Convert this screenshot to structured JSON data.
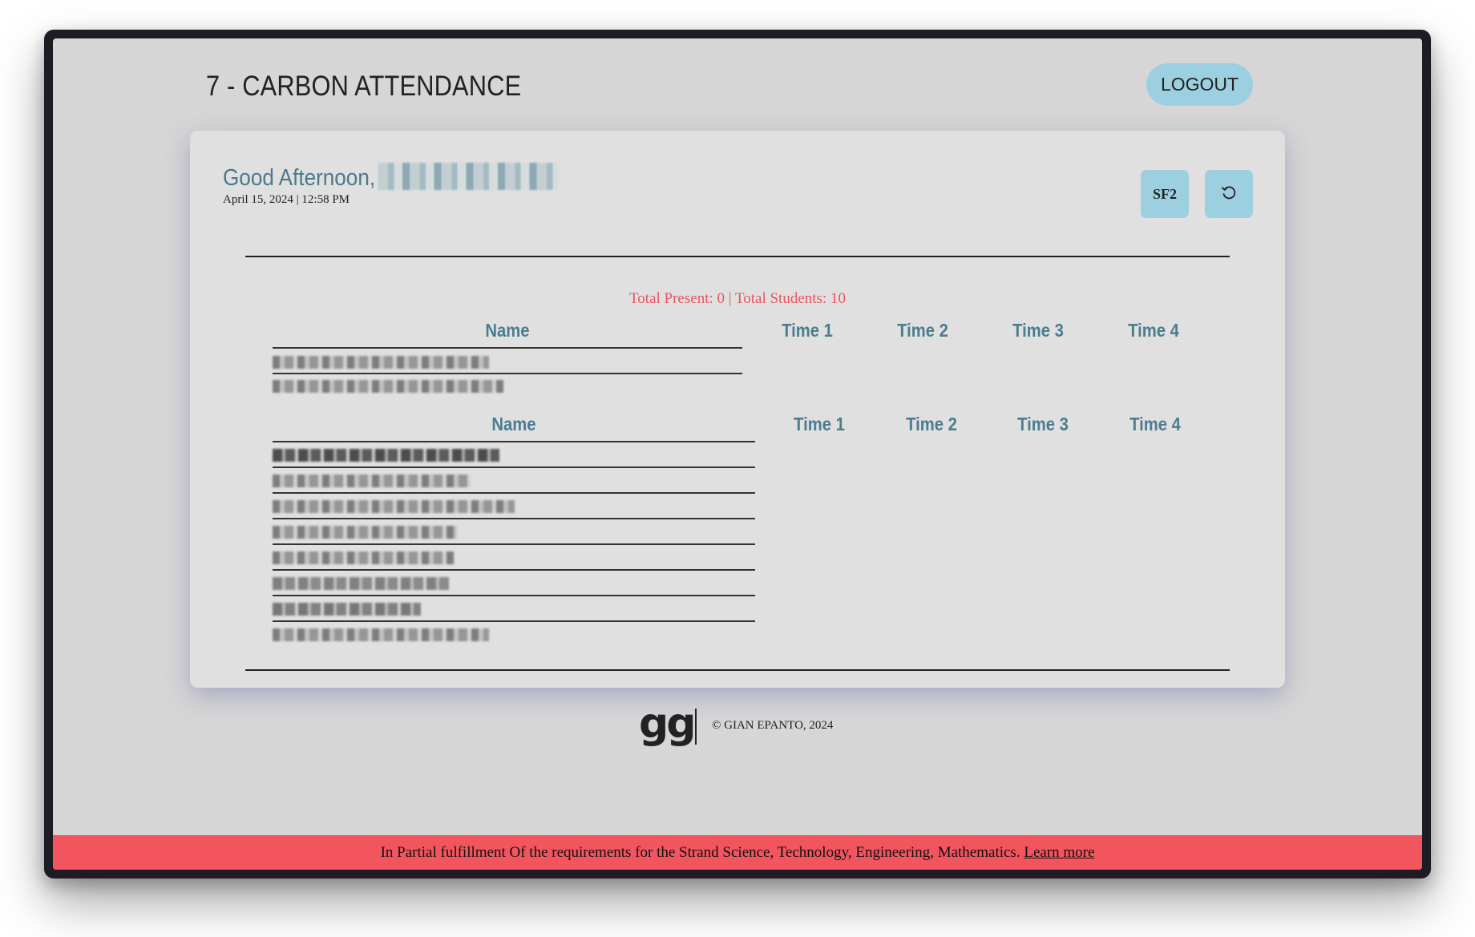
{
  "header": {
    "title": "7 - CARBON ATTENDANCE",
    "logout_label": "LOGOUT"
  },
  "card": {
    "greeting": "Good Afternoon,",
    "datetime": "April 15, 2024 | 12:58 PM",
    "sf2_label": "SF2",
    "refresh_icon": "refresh-icon",
    "totals": "Total Present: 0 | Total Students: 10"
  },
  "tables": [
    {
      "headers": [
        "Name",
        "Time 1",
        "Time 2",
        "Time 3",
        "Time 4"
      ],
      "rows": 2
    },
    {
      "headers": [
        "Name",
        "Time 1",
        "Time 2",
        "Time 3",
        "Time 4"
      ],
      "rows": 8
    }
  ],
  "footer": {
    "logo": "gg",
    "copyright": "© GIAN EPANTO, 2024"
  },
  "banner": {
    "text": "In Partial fulfillment Of the requirements for the Strand Science, Technology, Engineering, Mathematics.",
    "link": "Learn more"
  },
  "colors": {
    "accent": "#9cd0e0",
    "heading": "#4a7d8e",
    "alert": "#e85560",
    "banner": "#f2555d"
  }
}
